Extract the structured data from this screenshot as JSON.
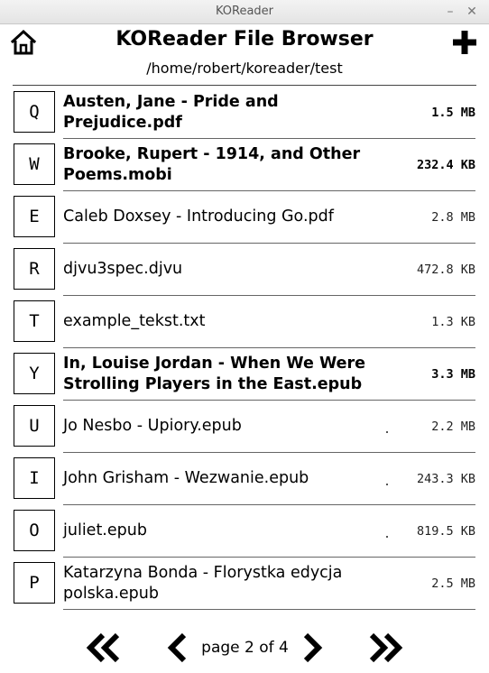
{
  "window": {
    "title": "KOReader",
    "minimize_glyph": "–",
    "close_glyph": "✕"
  },
  "header": {
    "title": "KOReader File Browser",
    "path": "/home/robert/koreader/test",
    "left_icon": "home-icon",
    "right_icon": "plus-icon"
  },
  "files": [
    {
      "key": "Q",
      "name": "Austen, Jane - Pride and Prejudice.pdf",
      "size": "1.5 MB",
      "bold": true,
      "dot": false
    },
    {
      "key": "W",
      "name": "Brooke, Rupert - 1914, and Other Poems.mobi",
      "size": "232.4 KB",
      "bold": true,
      "dot": false
    },
    {
      "key": "E",
      "name": "Caleb Doxsey - Introducing Go.pdf",
      "size": "2.8 MB",
      "bold": false,
      "dot": false
    },
    {
      "key": "R",
      "name": "djvu3spec.djvu",
      "size": "472.8 KB",
      "bold": false,
      "dot": false
    },
    {
      "key": "T",
      "name": "example_tekst.txt",
      "size": "1.3 KB",
      "bold": false,
      "dot": false
    },
    {
      "key": "Y",
      "name": "In, Louise Jordan - When We Were Strolling Players in the East.epub",
      "size": "3.3 MB",
      "bold": true,
      "dot": false
    },
    {
      "key": "U",
      "name": "Jo Nesbo - Upiory.epub",
      "size": "2.2 MB",
      "bold": false,
      "dot": true
    },
    {
      "key": "I",
      "name": "John Grisham - Wezwanie.epub",
      "size": "243.3 KB",
      "bold": false,
      "dot": true
    },
    {
      "key": "O",
      "name": "juliet.epub",
      "size": "819.5 KB",
      "bold": false,
      "dot": true
    },
    {
      "key": "P",
      "name": "Katarzyna Bonda - Florystka edycja polska.epub",
      "size": "2.5 MB",
      "bold": false,
      "dot": false
    }
  ],
  "footer": {
    "page_label": "page 2 of 4",
    "icons": [
      "first-page-icon",
      "previous-page-icon",
      "next-page-icon",
      "last-page-icon"
    ]
  }
}
